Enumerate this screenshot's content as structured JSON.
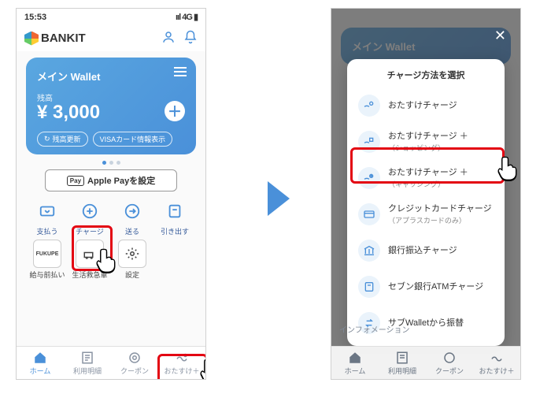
{
  "status": {
    "time": "15:53",
    "network": "4G"
  },
  "header": {
    "brand": "BANKIT"
  },
  "card": {
    "title": "メイン Wallet",
    "balance_label": "残高",
    "balance": "¥ 3,000",
    "refresh": "残高更新",
    "visa": "VISAカード情報表示"
  },
  "applepay": {
    "mark": "Pay",
    "label": "Apple Payを設定"
  },
  "actions": {
    "pay": "支払う",
    "charge": "チャージ",
    "send": "送る",
    "withdraw": "引き出す",
    "payroll": "給与前払い",
    "rescue": "生活救急車",
    "settings": "設定"
  },
  "nav": {
    "home": "ホーム",
    "history": "利用明細",
    "coupon": "クーポン",
    "otasuke": "おたすけ＋"
  },
  "sheet": {
    "title": "チャージ方法を選択",
    "opt1": "おたすけチャージ",
    "opt2": "おたすけチャージ ＋",
    "opt2sub": "（ショッピング）",
    "opt3": "おたすけチャージ ＋",
    "opt3sub": "（キャッシング）",
    "opt4": "クレジットカードチャージ",
    "opt4sub": "（アプラスカードのみ）",
    "opt5": "銀行振込チャージ",
    "opt6": "セブン銀行ATMチャージ",
    "opt7": "サブWalletから振替"
  },
  "right_info": "インフォメーション"
}
